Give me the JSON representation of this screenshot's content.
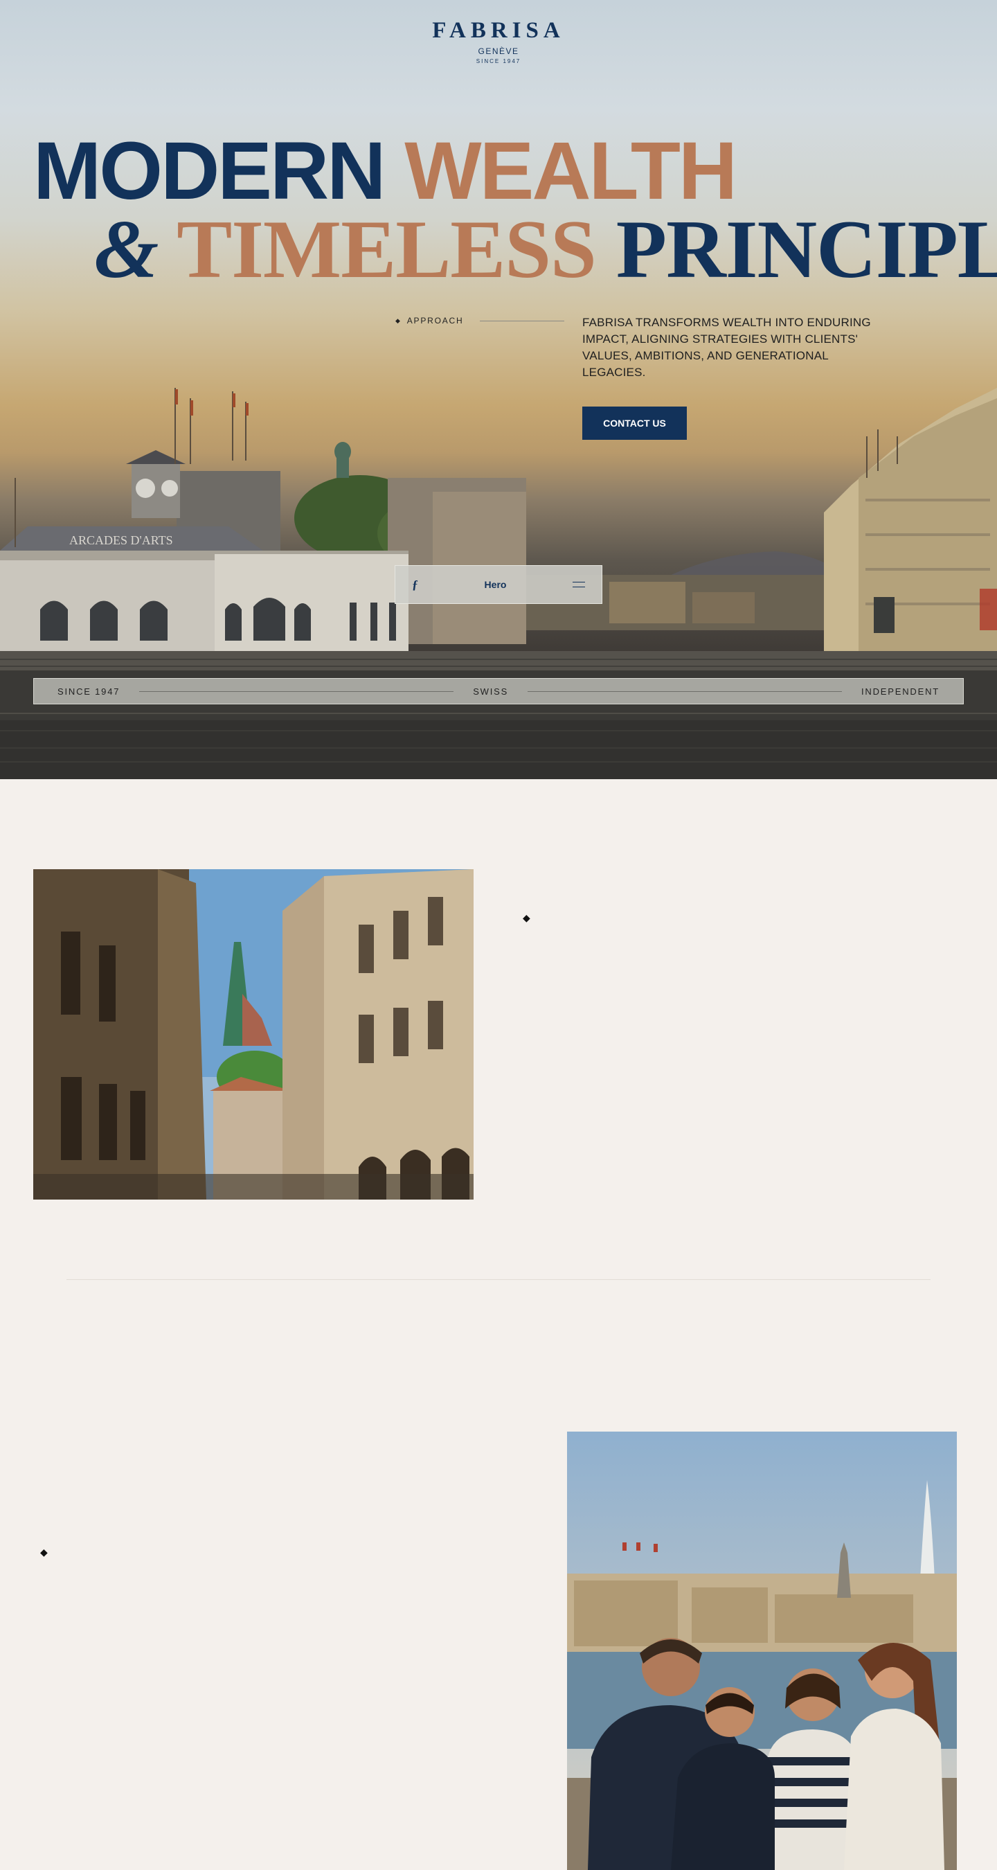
{
  "brand": {
    "name": "FABRISA",
    "city": "GENÈVE",
    "since": "SINCE 1947"
  },
  "hero": {
    "headline_line1": {
      "word1": "MODERN",
      "word2": "WEALTH"
    },
    "headline_line2": {
      "ampersand": "&",
      "word3": "TIMELESS",
      "word4": "PRINCIPLES"
    },
    "approach_label": "APPROACH",
    "intro": "FABRISA TRANSFORMS WEALTH INTO ENDURING IMPACT, ALIGNING STRATEGIES WITH CLIENTS' VALUES, AMBITIONS, AND GENERATIONAL LEGACIES.",
    "cta_label": "CONTACT US",
    "nav_label": "Hero",
    "building_sign": "ARCADES D'ARTS"
  },
  "strip": {
    "left": "SINCE 1947",
    "center": "SWISS",
    "right": "INDEPENDENT"
  },
  "colors": {
    "navy": "#12325a",
    "copper": "#b87a57",
    "cream": "#f4f0ec"
  },
  "icons": {
    "diamond": "◆",
    "nav_mark": "ƒ"
  }
}
